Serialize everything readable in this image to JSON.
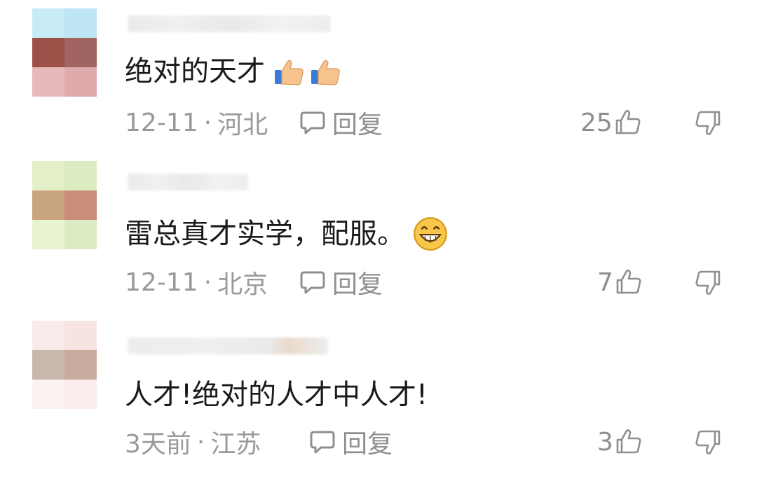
{
  "comments": [
    {
      "text": "绝对的天才",
      "emoji": "thumbs-up-icon",
      "date": "12-11",
      "location": "河北",
      "reply_label": "回复",
      "likes": "25",
      "avatar_colors": [
        "#c8ecf7",
        "#bfe6f5",
        "#9c5148",
        "#a06560",
        "#e7b9bb",
        "#dfaaac"
      ]
    },
    {
      "text": "雷总真才实学，配服。",
      "emoji": "grinning-face-icon",
      "date": "12-11",
      "location": "北京",
      "reply_label": "回复",
      "likes": "7",
      "avatar_colors": [
        "#e4f0c8",
        "#dcebc0",
        "#c8a580",
        "#c88e7a",
        "#e8f3d2",
        "#dcebc4"
      ]
    },
    {
      "text": "人才!绝对的人才中人才!",
      "emoji": "",
      "date": "3天前",
      "location": "江苏",
      "reply_label": "回复",
      "likes": "3",
      "avatar_colors": [
        "#f9ebe9",
        "#f7e4e2",
        "#c9b7ae",
        "#c8aca0",
        "#fbf2f1",
        "#faecec"
      ]
    }
  ],
  "separator": "·",
  "colors": {
    "text": "#1a1a1a",
    "meta": "#9a9a9a",
    "background": "#ffffff"
  }
}
